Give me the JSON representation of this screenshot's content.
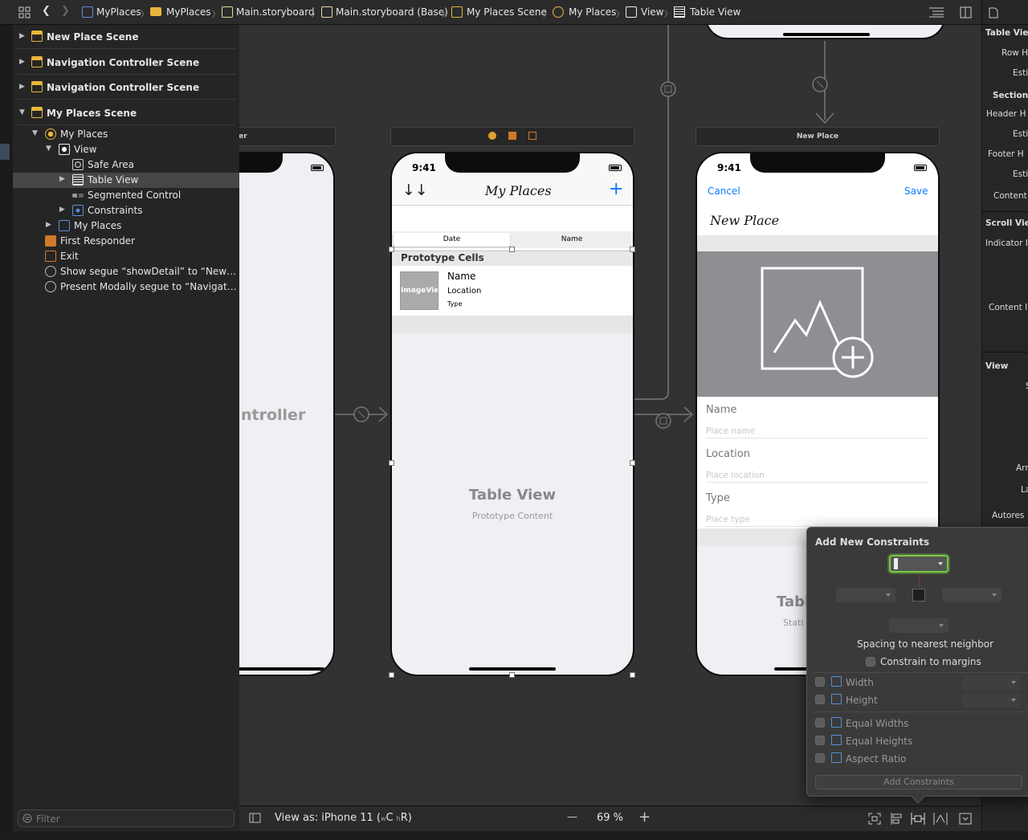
{
  "breadcrumb": [
    {
      "label": "MyPlaces",
      "icon": "swift-file-icon"
    },
    {
      "label": "MyPlaces",
      "icon": "folder-icon"
    },
    {
      "label": "Main.storyboard",
      "icon": "storyboard-file-icon"
    },
    {
      "label": "Main.storyboard (Base)",
      "icon": "storyboard-file-icon"
    },
    {
      "label": "My Places Scene",
      "icon": "scene-icon"
    },
    {
      "label": "My Places",
      "icon": "view-controller-icon"
    },
    {
      "label": "View",
      "icon": "view-icon"
    },
    {
      "label": "Table View",
      "icon": "table-view-icon"
    }
  ],
  "outline": {
    "scenes": [
      {
        "label": "New Place Scene",
        "expanded": false
      },
      {
        "label": "Navigation Controller Scene",
        "expanded": false
      },
      {
        "label": "Navigation Controller Scene",
        "expanded": false
      },
      {
        "label": "My Places Scene",
        "expanded": true
      }
    ],
    "items": [
      {
        "label": "My Places",
        "indent": 1,
        "disclosure": "open",
        "icon": "view-controller-icon"
      },
      {
        "label": "View",
        "indent": 2,
        "disclosure": "open",
        "icon": "view-icon"
      },
      {
        "label": "Safe Area",
        "indent": 3,
        "disclosure": "none",
        "icon": "safe-area-icon"
      },
      {
        "label": "Table View",
        "indent": 3,
        "disclosure": "closed",
        "icon": "table-view-icon",
        "selected": true
      },
      {
        "label": "Segmented Control",
        "indent": 3,
        "disclosure": "none",
        "icon": "segmented-control-icon"
      },
      {
        "label": "Constraints",
        "indent": 3,
        "disclosure": "closed",
        "icon": "constraints-icon"
      },
      {
        "label": "My Places",
        "indent": 2,
        "disclosure": "closed",
        "icon": "navigation-item-icon"
      },
      {
        "label": "First Responder",
        "indent": 1,
        "disclosure": "none",
        "icon": "first-responder-icon"
      },
      {
        "label": "Exit",
        "indent": 1,
        "disclosure": "none",
        "icon": "exit-icon"
      },
      {
        "label": "Show segue “showDetail” to “New…",
        "indent": 1,
        "disclosure": "none",
        "icon": "segue-icon"
      },
      {
        "label": "Present Modally segue to “Navigat…",
        "indent": 1,
        "disclosure": "none",
        "icon": "segue-icon"
      }
    ],
    "filter_placeholder": "Filter"
  },
  "canvas": {
    "left_phone": {
      "bar_label": "ller",
      "text": "ntroller"
    },
    "mid_phone": {
      "time": "9:41",
      "title": "My Places",
      "sort_glyph": "↓↓",
      "add_glyph": "+",
      "segments": [
        "Date",
        "Name"
      ],
      "section_header": "Prototype Cells",
      "cell": {
        "image_label": "ImageVie",
        "name": "Name",
        "location": "Location",
        "type": "Type"
      },
      "placeholder_title": "Table View",
      "placeholder_subtitle": "Prototype Content"
    },
    "right_phone": {
      "bar_label": "New Place",
      "time": "9:41",
      "cancel": "Cancel",
      "save": "Save",
      "title": "New Place",
      "fields": [
        {
          "label": "Name",
          "placeholder": "Place name"
        },
        {
          "label": "Location",
          "placeholder": "Place location"
        },
        {
          "label": "Type",
          "placeholder": "Place type"
        }
      ],
      "bottom_title": "Tabl",
      "bottom_sub": "Stati"
    }
  },
  "bottom_bar": {
    "view_as": "View as: iPhone 11 (",
    "size_w": "w",
    "size_c": "C",
    "size_h": "h",
    "size_r": "R)",
    "zoom": "69 %",
    "zoom_out": "—",
    "zoom_in": "+"
  },
  "constraints_popover": {
    "title": "Add New Constraints",
    "spacing_label": "Spacing to nearest neighbor",
    "margins_label": "Constrain to margins",
    "width": "Width",
    "height": "Height",
    "equal_widths": "Equal Widths",
    "equal_heights": "Equal Heights",
    "aspect_ratio": "Aspect Ratio",
    "add_button": "Add Constraints"
  },
  "inspector": {
    "table_view_header": "Table View",
    "row_height": "Row H",
    "estimate": "Esti",
    "sections": "Sections",
    "header_height": "Header H",
    "estimate2": "Esti",
    "footer_height": "Footer H",
    "estimate3": "Esti",
    "content": "Content",
    "scroll_view": "Scroll View",
    "indicator": "Indicator I",
    "content_insets": "Content I",
    "view": "View",
    "s": "S",
    "arrange": "Arr",
    "layout": "La",
    "autoresize": "Autores"
  },
  "colors": {
    "accent": "#0a7aff",
    "canvas": "#323232",
    "sidebar": "#252525",
    "selection": "#464646",
    "focus_green": "#7ac943"
  }
}
